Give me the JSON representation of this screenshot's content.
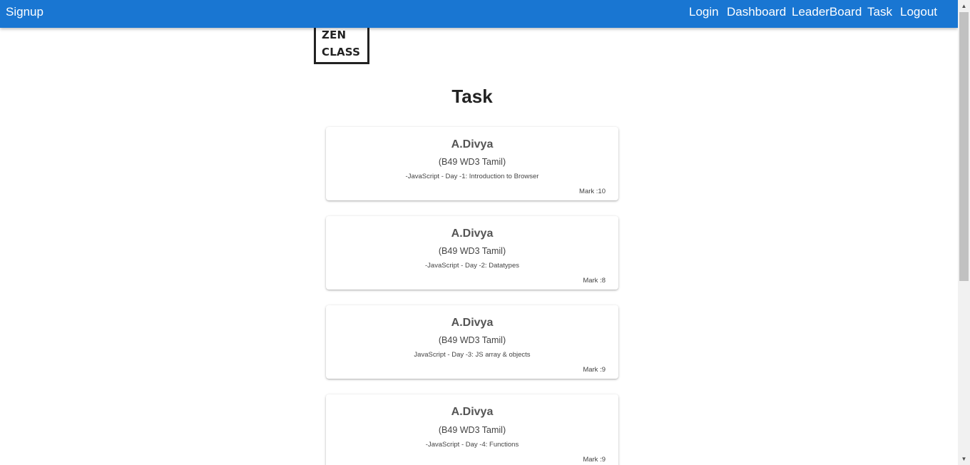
{
  "navbar": {
    "brand_label": "Signup",
    "links": {
      "login": "Login",
      "dashboard": "Dashboard",
      "leaderboard": "LeaderBoard",
      "task": "Task",
      "logout": "Logout"
    },
    "color": "#1976d2"
  },
  "logo": {
    "line1": "ZEN",
    "line2": "CLASS"
  },
  "page": {
    "title": "Task"
  },
  "tasks": [
    {
      "name": "A.Divya",
      "batch": "(B49 WD3 Tamil)",
      "topic": "-JavaScript - Day -1: Introduction to Browser",
      "mark": "Mark :10"
    },
    {
      "name": "A.Divya",
      "batch": "(B49 WD3 Tamil)",
      "topic": "-JavaScript - Day -2: Datatypes",
      "mark": "Mark :8"
    },
    {
      "name": "A.Divya",
      "batch": "(B49 WD3 Tamil)",
      "topic": "JavaScript - Day -3: JS array & objects",
      "mark": "Mark :9"
    },
    {
      "name": "A.Divya",
      "batch": "(B49 WD3 Tamil)",
      "topic": "-JavaScript - Day -4: Functions",
      "mark": "Mark :9"
    }
  ],
  "scrollbar": {
    "up_icon": "triangle-up",
    "down_icon": "triangle-down"
  }
}
